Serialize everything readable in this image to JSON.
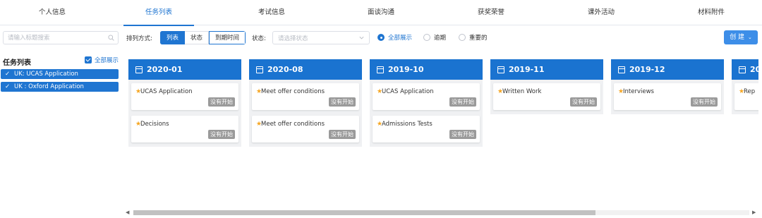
{
  "tabs": [
    {
      "label": "个人信息",
      "active": false
    },
    {
      "label": "任务列表",
      "active": true
    },
    {
      "label": "考试信息",
      "active": false
    },
    {
      "label": "面谈沟通",
      "active": false
    },
    {
      "label": "获奖荣誉",
      "active": false
    },
    {
      "label": "课外活动",
      "active": false
    },
    {
      "label": "材料附件",
      "active": false
    }
  ],
  "sidebar": {
    "search_placeholder": "请输入标题搜索",
    "title": "任务列表",
    "show_all": "全部展示",
    "applications": [
      {
        "label": "UK: UCAS Application"
      },
      {
        "label": "UK : Oxford Application"
      }
    ]
  },
  "toolbar": {
    "sort_label": "排列方式:",
    "sort_options": [
      "列表",
      "状态",
      "到期时间"
    ],
    "sort_selected": "列表",
    "status_label": "状态:",
    "status_placeholder": "请选择状态",
    "filters": [
      {
        "label": "全部展示",
        "checked": true
      },
      {
        "label": "逾期",
        "checked": false
      },
      {
        "label": "重要的",
        "checked": false
      }
    ],
    "create_label": "创 建"
  },
  "columns": [
    {
      "date": "2020-01",
      "cards": [
        {
          "title": "UCAS Application",
          "status": "没有开始"
        },
        {
          "title": "Decisions",
          "status": "没有开始"
        }
      ]
    },
    {
      "date": "2020-08",
      "cards": [
        {
          "title": "Meet offer conditions",
          "status": "没有开始"
        },
        {
          "title": "Meet offer conditions",
          "status": "没有开始"
        }
      ]
    },
    {
      "date": "2019-10",
      "cards": [
        {
          "title": "UCAS Application",
          "status": "没有开始"
        },
        {
          "title": "Admissions Tests",
          "status": "没有开始"
        }
      ]
    },
    {
      "date": "2019-11",
      "cards": [
        {
          "title": "Written Work",
          "status": "没有开始"
        }
      ]
    },
    {
      "date": "2019-12",
      "cards": [
        {
          "title": "Interviews",
          "status": "没有开始"
        }
      ]
    },
    {
      "date": "20",
      "cards": [
        {
          "title": "Rep",
          "status": ""
        }
      ]
    }
  ],
  "scrollbar": {
    "position": 0.0,
    "visible_fraction": 0.75
  },
  "colors": {
    "accent": "#1f75d1",
    "header": "#1a73d0",
    "star": "#f5a623",
    "badge": "#9a9a9a"
  }
}
